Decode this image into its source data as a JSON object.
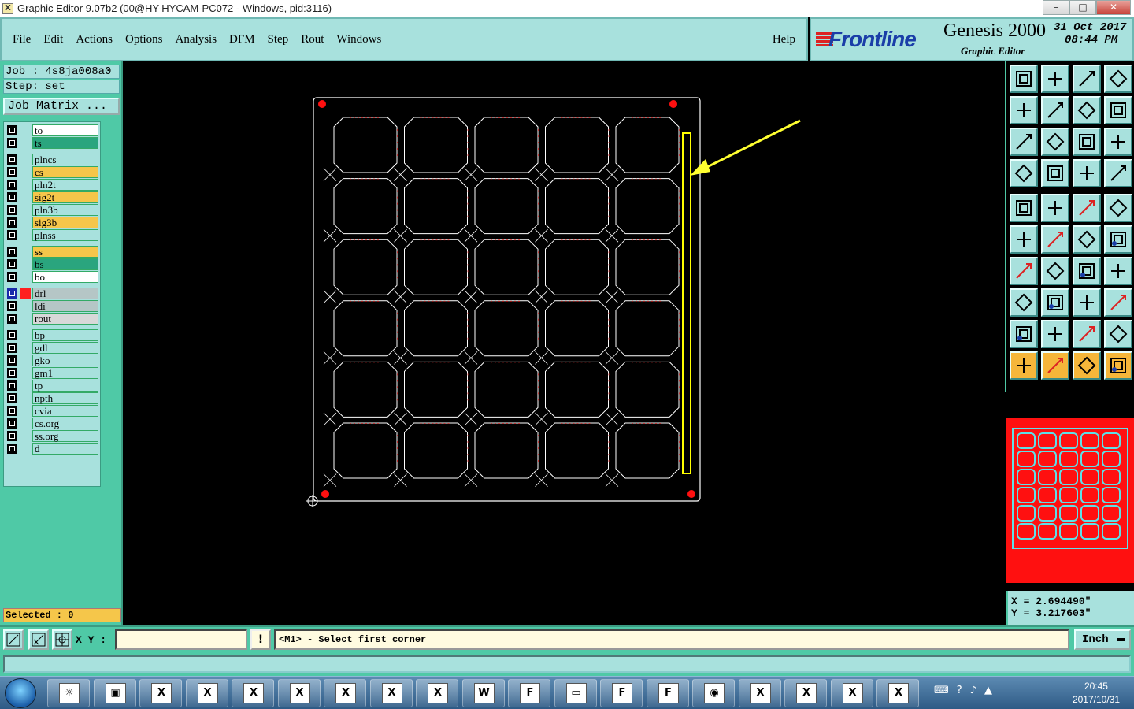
{
  "window": {
    "title": "Graphic Editor 9.07b2 (00@HY-HYCAM-PC072 - Windows, pid:3116)",
    "btn_min": "–",
    "btn_max": "□",
    "btn_close": "✕"
  },
  "menu": {
    "items": [
      "File",
      "Edit",
      "Actions",
      "Options",
      "Analysis",
      "DFM",
      "Step",
      "Rout",
      "Windows"
    ],
    "help": "Help"
  },
  "logo": {
    "brand": "Frontline",
    "product": "Genesis 2000",
    "subtitle": "Graphic Editor",
    "date": "31 Oct 2017",
    "time": "08:44 PM"
  },
  "job": {
    "job_line": "Job : 4s8ja008a0",
    "step_line": "Step: set",
    "matrix_button": "Job Matrix ..."
  },
  "layers": [
    {
      "name": "to",
      "color": "#ffffff",
      "group": 0
    },
    {
      "name": "ts",
      "color": "#2aa57e",
      "group": 0
    },
    {
      "name": "plncs",
      "color": "#a8e1dd",
      "group": 1
    },
    {
      "name": "cs",
      "color": "#f5c64a",
      "group": 1
    },
    {
      "name": "pln2t",
      "color": "#a8e1dd",
      "group": 1
    },
    {
      "name": "sig2t",
      "color": "#f5c64a",
      "group": 1
    },
    {
      "name": "pln3b",
      "color": "#a8e1dd",
      "group": 1
    },
    {
      "name": "sig3b",
      "color": "#f5c64a",
      "group": 1
    },
    {
      "name": "plnss",
      "color": "#a8e1dd",
      "group": 1
    },
    {
      "name": "ss",
      "color": "#f5c64a",
      "group": 2
    },
    {
      "name": "bs",
      "color": "#2aa57e",
      "group": 2
    },
    {
      "name": "bo",
      "color": "#ffffff",
      "group": 2
    },
    {
      "name": "drl",
      "color": "#b5c6c6",
      "group": 3,
      "active": true
    },
    {
      "name": "ldi",
      "color": "#b5c6c6",
      "group": 3
    },
    {
      "name": "rout",
      "color": "#d8d8d8",
      "group": 3
    },
    {
      "name": "bp",
      "color": "#a8e1dd",
      "group": 4
    },
    {
      "name": "gdl",
      "color": "#a8e1dd",
      "group": 4
    },
    {
      "name": "gko",
      "color": "#a8e1dd",
      "group": 4
    },
    {
      "name": "gm1",
      "color": "#a8e1dd",
      "group": 4
    },
    {
      "name": "tp",
      "color": "#a8e1dd",
      "group": 4
    },
    {
      "name": "npth",
      "color": "#a8e1dd",
      "group": 4
    },
    {
      "name": "cvia",
      "color": "#a8e1dd",
      "group": 4
    },
    {
      "name": "cs.org",
      "color": "#a8e1dd",
      "group": 4
    },
    {
      "name": "ss.org",
      "color": "#a8e1dd",
      "group": 4
    },
    {
      "name": "d",
      "color": "#a8e1dd",
      "group": 4
    }
  ],
  "selected": "Selected : 0",
  "coords": {
    "x": "X = 2.694490\"",
    "y": "Y = 3.217603\""
  },
  "command": {
    "xy_label": "X Y :",
    "xy_value": "",
    "prompt": "<M1> - Select first corner",
    "units": "Inch",
    "warn": "!"
  },
  "canvas": {
    "grid_rows": 6,
    "grid_cols": 5,
    "colors": {
      "outline": "#ffffff",
      "pad": "#ff1010",
      "highlight": "#ffff00",
      "arrow": "#ffff30",
      "trace": "#d02020"
    }
  },
  "taskbar": {
    "time": "20:45",
    "date": "2017/10/31"
  }
}
